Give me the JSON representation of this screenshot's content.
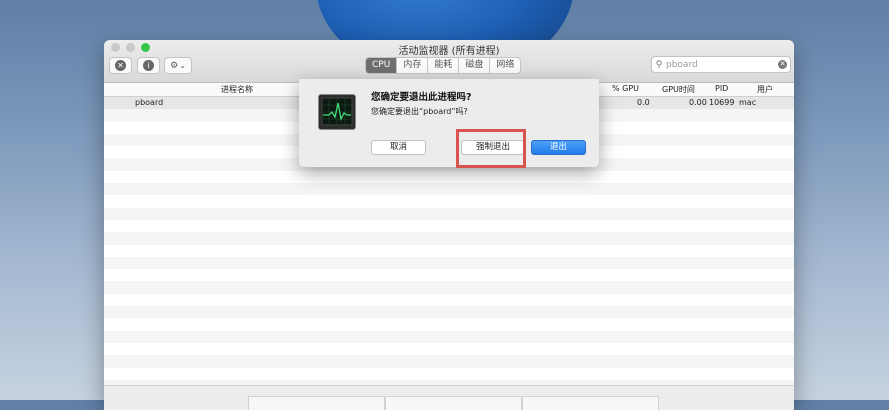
{
  "window": {
    "title": "活动监视器 (所有进程)",
    "tabs": [
      "CPU",
      "内存",
      "能耗",
      "磁盘",
      "网络"
    ],
    "active_tab": "CPU",
    "search": {
      "value": "pboard"
    },
    "toolbar": {
      "stop_glyph": "✕",
      "info_glyph": "i",
      "gear_glyph": "⚙",
      "chevron_glyph": "⌄"
    }
  },
  "table": {
    "columns": {
      "name": "进程名称",
      "gpu_pct": "% GPU",
      "gpu_time": "GPU时间",
      "pid": "PID",
      "user": "用户"
    },
    "rows": [
      {
        "name": "pboard",
        "gpu_pct": "0.0",
        "gpu_time": "0.00",
        "pid": "10699",
        "user": "mac"
      }
    ]
  },
  "dialog": {
    "title": "您确定要退出此进程吗?",
    "message": "您确定要退出“pboard”吗?",
    "cancel_label": "取消",
    "force_quit_label": "强制退出",
    "quit_label": "退出"
  },
  "colors": {
    "highlight": "#d9534f",
    "accent": "#2479e8"
  }
}
